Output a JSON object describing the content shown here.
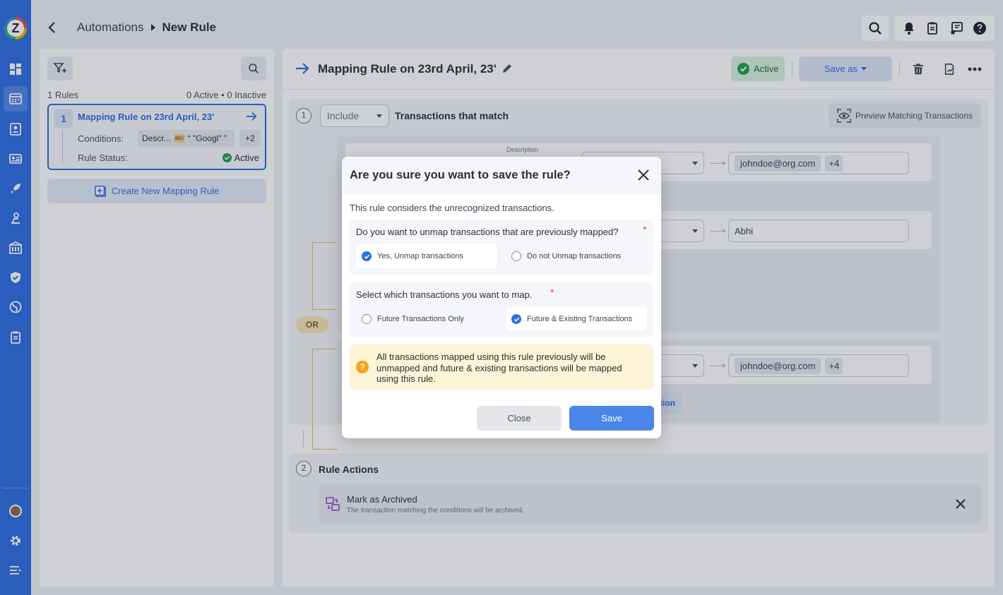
{
  "app": {
    "breadcrumb": [
      "Automations",
      "New Rule"
    ],
    "colors": {
      "rail": "#2f6ee0",
      "accent": "#2f6ee0",
      "success": "#1e9e4a",
      "warning": "#f2a516"
    }
  },
  "topbar_icons": [
    "search-icon",
    "bell-icon",
    "clipboard-icon",
    "message-star-icon",
    "help-icon"
  ],
  "sidebar_icons": [
    "dashboard-icon",
    "calendar-table-icon",
    "contacts-icon",
    "id-card-icon",
    "rocket-icon",
    "user-settings-icon",
    "building-icon",
    "shield-check-icon",
    "globe-icon",
    "report-icon",
    "settings-icon",
    "collapse-menu-icon"
  ],
  "left_panel": {
    "rules_count": "1 Rules",
    "rules_status": "0 Active • 0 Inactive",
    "rule": {
      "number": "1",
      "title": "Mapping Rule on 23rd April, 23'",
      "conditions_label": "Conditions:",
      "condition_field": "Descr...",
      "condition_value": "“ \"Googl\" ”",
      "condition_more": "+2",
      "status_label": "Rule Status:",
      "status_value": "Active"
    },
    "create_label": "Create New Mapping Rule"
  },
  "main": {
    "title": "Mapping Rule on 23rd April, 23'",
    "status": "Active",
    "save_as": "Save as",
    "section1": {
      "step": "1",
      "include": "Include",
      "heading": "Transactions that match",
      "preview_label": "Preview Matching Transactions",
      "description_label": "Description",
      "or_label": "OR",
      "rows": [
        {
          "value": "johndoe@org.com",
          "more": "+4"
        },
        {
          "value": "Abhi"
        },
        {
          "value": "johndoe@org.com",
          "more": "+4"
        }
      ],
      "partial_link": "tion"
    },
    "section2": {
      "step": "2",
      "heading": "Rule Actions",
      "action_title": "Mark as Archived",
      "action_desc": "The transaction matching the conditions will be archived."
    }
  },
  "modal": {
    "title": "Are you sure you want to save the rule?",
    "intro": "This rule considers the unrecognized transactions.",
    "q1": {
      "label": "Do you want to unmap transactions that are previously mapped?",
      "required": "*",
      "options": [
        "Yes, Unmap transactions",
        "Do not Unmap transactions"
      ],
      "selected": "Yes, Unmap transactions"
    },
    "q2": {
      "label": "Select which transactions you want to map.",
      "required": "*",
      "options": [
        "Future Transactions Only",
        "Future & Existing Transactions"
      ],
      "selected": "Future & Existing Transactions"
    },
    "warning": "All transactions mapped using this rule previously will be unmapped and future & existing transactions will be mapped using this rule.",
    "warning_icon": "?",
    "close_label": "Close",
    "save_label": "Save"
  }
}
